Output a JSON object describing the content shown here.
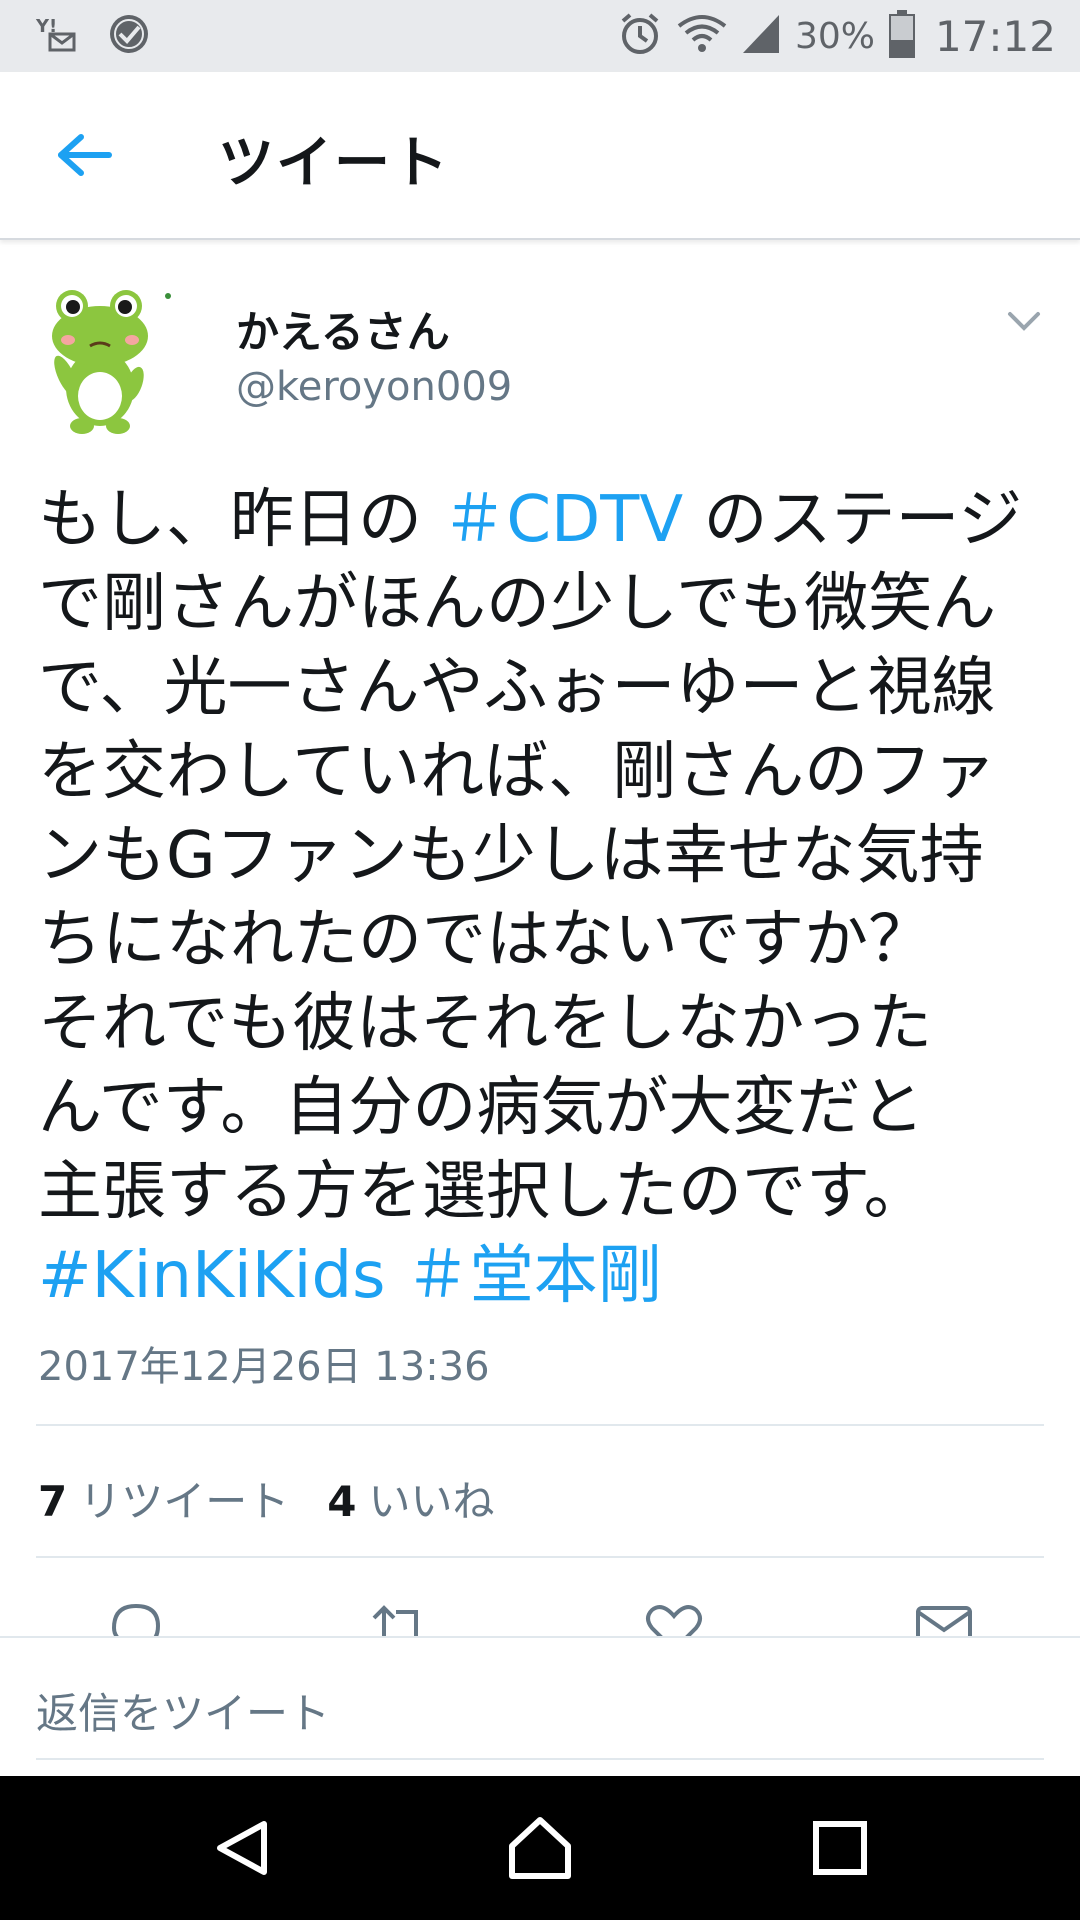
{
  "status_bar": {
    "battery_percent": "30%",
    "time": "17:12",
    "icons": [
      "yahoo-mail-icon",
      "check-circle-icon",
      "alarm-icon",
      "wifi-icon",
      "signal-icon",
      "battery-icon"
    ]
  },
  "header": {
    "title": "ツイート",
    "back_icon": "back-arrow-icon"
  },
  "tweet": {
    "author_name": "かえるさん",
    "author_handle": "@keroyon009",
    "lines": [
      {
        "pre": "もし、昨日の ",
        "tag": "＃CDTV",
        "post": " のステージ"
      },
      {
        "pre": "で剛さんがほんの少しでも微笑ん",
        "tag": "",
        "post": ""
      },
      {
        "pre": "で、光一さんやふぉーゆーと視線",
        "tag": "",
        "post": ""
      },
      {
        "pre": "を交わしていれば、剛さんのファ",
        "tag": "",
        "post": ""
      },
      {
        "pre": "ンもGファンも少しは幸せな気持",
        "tag": "",
        "post": ""
      },
      {
        "pre": "ちになれたのではないですか？",
        "tag": "",
        "post": ""
      },
      {
        "pre": "それでも彼はそれをしなかった",
        "tag": "",
        "post": ""
      },
      {
        "pre": "んです。自分の病気が大変だと",
        "tag": "",
        "post": ""
      },
      {
        "pre": "主張する方を選択したのです。",
        "tag": "",
        "post": ""
      }
    ],
    "hashtags": [
      "#KinKiKids",
      "＃堂本剛"
    ],
    "timestamp": "2017年12月26日 13:36"
  },
  "stats": {
    "retweets_count": "7",
    "retweets_label": "リツイート",
    "likes_count": "4",
    "likes_label": "いいね"
  },
  "actions": [
    "reply-icon",
    "retweet-icon",
    "like-icon",
    "share-icon"
  ],
  "reply": {
    "placeholder": "返信をツイート"
  },
  "colors": {
    "accent": "#1da1f2",
    "text": "#14171a",
    "secondary": "#657786",
    "divider": "#e1e8ed",
    "status_bar_bg": "#e8eaed"
  },
  "nav": [
    "nav-back-icon",
    "nav-home-icon",
    "nav-recents-icon"
  ]
}
